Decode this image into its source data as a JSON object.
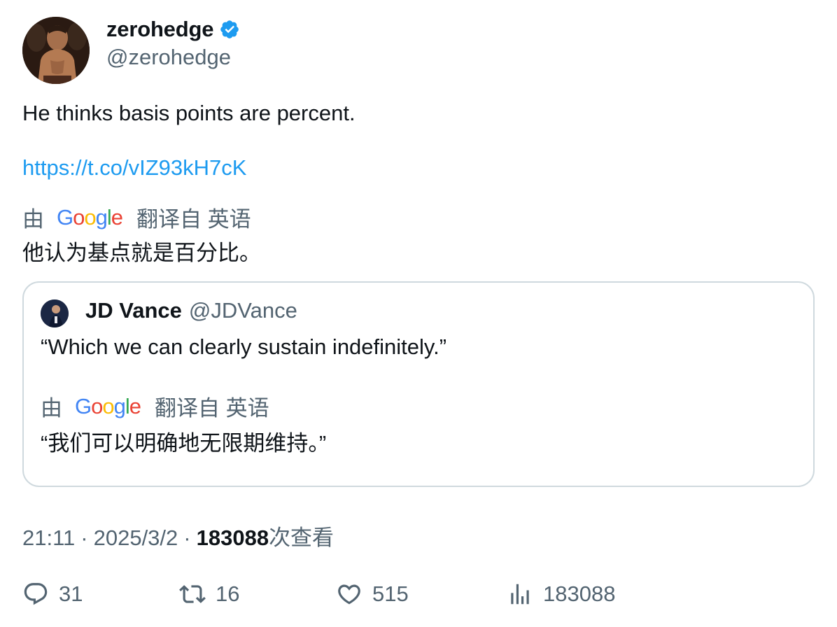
{
  "author": {
    "display_name": "zerohedge",
    "handle": "@zerohedge",
    "verified": true
  },
  "tweet": {
    "text": "He thinks basis points are percent.",
    "link": "https://t.co/vIZ93kH7cK",
    "translation_by": "由",
    "translation_source": "翻译自 英语",
    "translation_text": "他认为基点就是百分比。"
  },
  "quote": {
    "display_name": "JD Vance",
    "handle": "@JDVance",
    "text": "“Which we can clearly sustain indefinitely.”",
    "translation_by": "由",
    "translation_source": "翻译自 英语",
    "translation_text": "“我们可以明确地无限期维持。”"
  },
  "meta": {
    "time": "21:11",
    "separator": "·",
    "date": "2025/3/2",
    "views": "183088",
    "views_label": "次查看"
  },
  "actions": {
    "replies": "31",
    "retweets": "16",
    "likes": "515",
    "views": "183088"
  },
  "colors": {
    "link": "#1d9bf0",
    "secondary_text": "#536471",
    "border": "#cfd9de",
    "verified": "#1d9bf0"
  },
  "google_logo_letters": [
    "G",
    "o",
    "o",
    "g",
    "l",
    "e"
  ],
  "icons": {
    "reply": "reply-icon",
    "retweet": "retweet-icon",
    "like": "heart-icon",
    "views": "analytics-icon",
    "verified": "verified-badge-icon"
  }
}
